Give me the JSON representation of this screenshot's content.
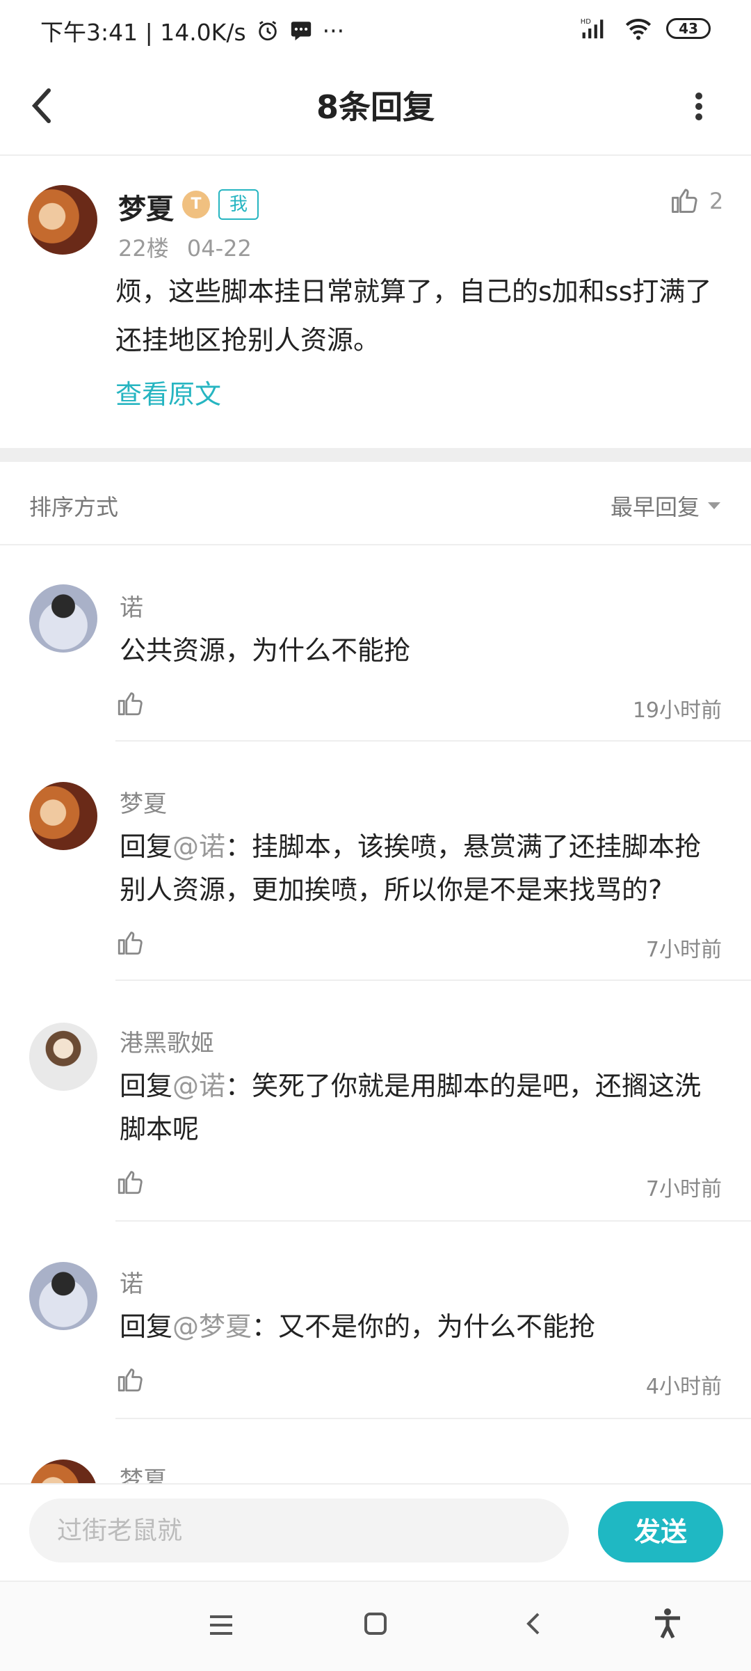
{
  "status_bar": {
    "time_speed": "下午3:41 | 14.0K/s",
    "more": "···",
    "network": "HD",
    "battery": "43"
  },
  "header": {
    "title": "8条回复"
  },
  "original_post": {
    "author": "梦夏",
    "badge_level": "T",
    "badge_me": "我",
    "likes": "2",
    "floor": "22楼",
    "date": "04-22",
    "content": "烦，这些脚本挂日常就算了，自己的s加和ss打满了还挂地区抢别人资源。",
    "view_original": "查看原文"
  },
  "sort": {
    "label": "排序方式",
    "selected": "最早回复"
  },
  "replies": [
    {
      "author": "诺",
      "mention": "",
      "content": "公共资源，为什么不能抢",
      "time": "19小时前"
    },
    {
      "author": "梦夏",
      "mention": "@诺",
      "content": "：挂脚本，该挨喷，悬赏满了还挂脚本抢别人资源，更加挨喷，所以你是不是来找骂的?",
      "time": "7小时前"
    },
    {
      "author": "港黑歌姬",
      "mention": "@诺",
      "content": "：笑死了你就是用脚本的是吧，还搁这洗脚本呢",
      "time": "7小时前"
    },
    {
      "author": "诺",
      "mention": "@梦夏",
      "content": "：又不是你的，为什么不能抢",
      "time": "4小时前"
    },
    {
      "author": "梦夏"
    }
  ],
  "reply_prefix": "回复",
  "input": {
    "placeholder": "过街老鼠就"
  },
  "send_label": "发送",
  "colors": {
    "accent": "#26b5c1",
    "send": "#1fb8c3"
  }
}
